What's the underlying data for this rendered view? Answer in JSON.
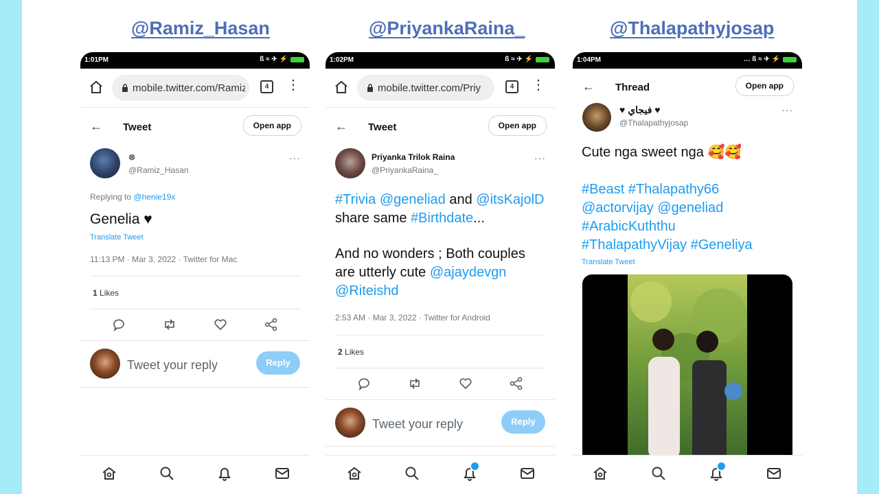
{
  "handles": [
    "@Ramiz_Hasan",
    "@PriyankaRaina_",
    "@Thalapathyjosap"
  ],
  "phones": [
    {
      "status_time": "1:01PM",
      "status_icons": "ß ≈ ✈ ⚡",
      "status_batt": "95",
      "url": "mobile.twitter.com/Ramiz",
      "tab_count": "4",
      "header_title": "Tweet",
      "open_app": "Open app",
      "display_name": "⊗",
      "username": "@Ramiz_Hasan",
      "replying_prefix": "Replying to",
      "replying_to": "@henie19x",
      "text": "Genelia ♥",
      "translate": "Translate Tweet",
      "meta": "11:13 PM · Mar 3, 2022 · Twitter for Mac",
      "likes_count": "1",
      "likes_label": "Likes",
      "reply_placeholder": "Tweet your reply",
      "reply_button": "Reply"
    },
    {
      "status_time": "1:02PM",
      "status_icons": "ß ≈ ✈ ⚡",
      "status_batt": "95",
      "url": "mobile.twitter.com/Priy",
      "tab_count": "4",
      "header_title": "Tweet",
      "open_app": "Open app",
      "display_name": "Priyanka Trilok Raina",
      "username": "@PriyankaRaina_",
      "line1_tag1": "#Trivia",
      "line1_tag2": "@geneliad",
      "line1_and": " and ",
      "line1_tag3": "@itsKajolD",
      "line2_text": "share same ",
      "line2_tag": "#Birthdate",
      "line2_end": "...",
      "line3": "And no wonders ; Both couples",
      "line4_text": "are utterly cute ",
      "line4_tag": "@ajaydevgn",
      "line5_tag": "@Riteishd",
      "meta": "2:53 AM · Mar 3, 2022 · Twitter for Android",
      "likes_count": "2",
      "likes_label": "Likes",
      "reply_placeholder": "Tweet your reply",
      "reply_button": "Reply"
    },
    {
      "status_time": "1:04PM",
      "status_icons": "… ß ≈ ✈ ⚡",
      "status_batt": "95",
      "header_title": "Thread",
      "open_app": "Open app",
      "display_name": "♥ فيجاي ♥",
      "username": "@Thalapathyjosap",
      "line1": "Cute nga sweet nga 🥰🥰",
      "tags_line1": "#Beast #Thalapathy66",
      "tags_line2": "@actorvijay @geneliad",
      "tags_line3": "#ArabicKuththu",
      "tags_line4": "#ThalapathyVijay #Geneliya",
      "translate": "Translate Tweet"
    }
  ],
  "colors": {
    "outer_bg": "#a6ecf7",
    "handle": "#4c6fb8",
    "link": "#1d9bf0",
    "reply_button": "#8ecdf8"
  }
}
